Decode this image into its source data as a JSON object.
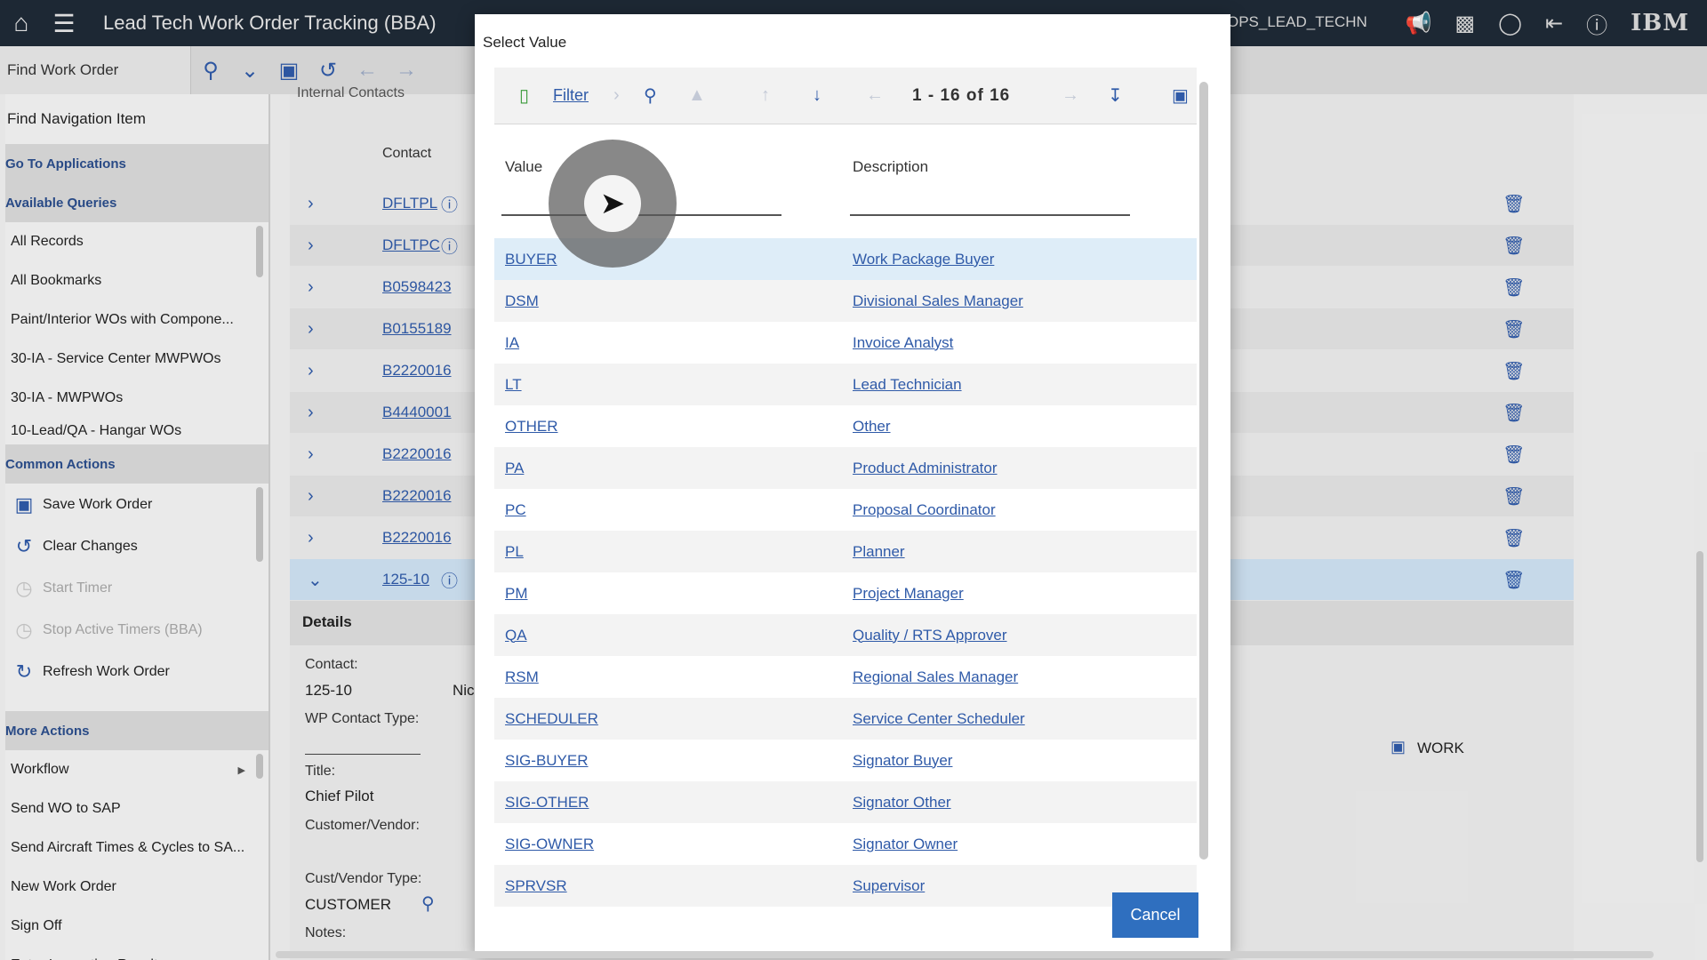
{
  "header": {
    "app_title": "Lead Tech Work Order Tracking (BBA)",
    "user": "OPS_LEAD_TECHN",
    "brand": "IBM"
  },
  "toolbar": {
    "find_work_order": "Find Work Order"
  },
  "sidebar": {
    "find_nav": "Find Navigation Item",
    "go_to_apps": "Go To Applications",
    "available_queries": "Available Queries",
    "queries": [
      "All Records",
      "All Bookmarks",
      "Paint/Interior WOs with Compone...",
      "30-IA - Service Center MWPWOs",
      "30-IA - MWPWOs",
      "10-Lead/QA - Hangar WOs"
    ],
    "common_actions": "Common Actions",
    "actions": [
      {
        "label": "Save Work Order",
        "icon": "save-icon",
        "enabled": true
      },
      {
        "label": "Clear Changes",
        "icon": "undo-icon",
        "enabled": true
      },
      {
        "label": "Start Timer",
        "icon": "timer-icon",
        "enabled": false
      },
      {
        "label": "Stop Active Timers (BBA)",
        "icon": "timer-stop-icon",
        "enabled": false
      },
      {
        "label": "Refresh Work Order",
        "icon": "refresh-icon",
        "enabled": true
      }
    ],
    "more_actions": "More Actions",
    "more": [
      "Workflow",
      "Send WO to SAP",
      "Send Aircraft Times & Cycles to SA...",
      "New Work Order",
      "Sign Off",
      "Enter Inspection Results"
    ]
  },
  "main": {
    "section_title": "Internal Contacts",
    "contact_header": "Contact",
    "contacts": [
      "DFLTPL",
      "DFLTPC",
      "B0598423",
      "B0155189",
      "B2220016",
      "B4440001",
      "B2220016",
      "B2220016",
      "B2220016",
      "125-10"
    ],
    "details_title": "Details",
    "contact_label": "Contact:",
    "contact_value": "125-10",
    "contact_name_partial": "Nic",
    "wp_contact_type_label": "WP Contact Type:",
    "title_label": "Title:",
    "title_value": "Chief Pilot",
    "customer_vendor_label": "Customer/Vendor:",
    "cust_vendor_type_label": "Cust/Vendor Type:",
    "cust_vendor_type_value": "CUSTOMER",
    "notes_label": "Notes:",
    "work_label": "WORK"
  },
  "dialog": {
    "title": "Select Value",
    "filter_label": "Filter",
    "page_info": "1 - 16 of 16",
    "value_header": "Value",
    "description_header": "Description",
    "rows": [
      {
        "value": "BUYER",
        "description": "Work Package Buyer"
      },
      {
        "value": "DSM",
        "description": "Divisional Sales Manager"
      },
      {
        "value": "IA",
        "description": "Invoice Analyst"
      },
      {
        "value": "LT",
        "description": "Lead Technician"
      },
      {
        "value": "OTHER",
        "description": "Other"
      },
      {
        "value": "PA",
        "description": "Product Administrator"
      },
      {
        "value": "PC",
        "description": "Proposal Coordinator"
      },
      {
        "value": "PL",
        "description": "Planner"
      },
      {
        "value": "PM",
        "description": "Project Manager"
      },
      {
        "value": "QA",
        "description": "Quality / RTS Approver"
      },
      {
        "value": "RSM",
        "description": "Regional Sales Manager"
      },
      {
        "value": "SCHEDULER",
        "description": "Service Center Scheduler"
      },
      {
        "value": "SIG-BUYER",
        "description": "Signator Buyer"
      },
      {
        "value": "SIG-OTHER",
        "description": "Signator Other"
      },
      {
        "value": "SIG-OWNER",
        "description": "Signator Owner"
      },
      {
        "value": "SPRVSR",
        "description": "Supervisor"
      }
    ],
    "cancel_label": "Cancel"
  },
  "colors": {
    "topbar": "#1f2a37",
    "link": "#2f5aa8",
    "primary_button": "#2f6fbf",
    "selected_row": "#deedf8"
  }
}
